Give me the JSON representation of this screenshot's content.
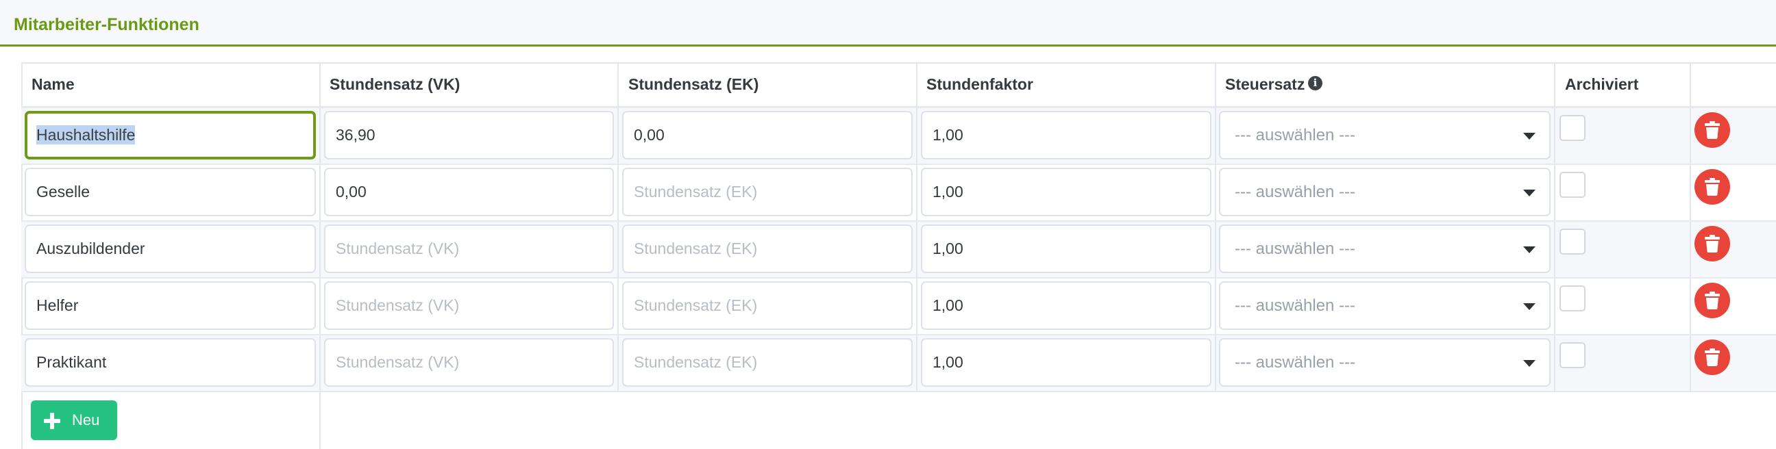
{
  "panel": {
    "title": "Mitarbeiter-Funktionen"
  },
  "table": {
    "headers": {
      "name": "Name",
      "vk": "Stundensatz (VK)",
      "ek": "Stundensatz (EK)",
      "factor": "Stundenfaktor",
      "tax": "Steuersatz",
      "archived": "Archiviert"
    },
    "placeholders": {
      "vk": "Stundensatz (VK)",
      "ek": "Stundensatz (EK)"
    },
    "select_placeholder": "--- auswählen ---",
    "rows": [
      {
        "name": "Haushaltshilfe",
        "vk": "36,90",
        "ek": "0,00",
        "factor": "1,00",
        "tax": "--- auswählen ---",
        "archived": false
      },
      {
        "name": "Geselle",
        "vk": "0,00",
        "ek": "",
        "factor": "1,00",
        "tax": "--- auswählen ---",
        "archived": false
      },
      {
        "name": "Auszubildender",
        "vk": "",
        "ek": "",
        "factor": "1,00",
        "tax": "--- auswählen ---",
        "archived": false
      },
      {
        "name": "Helfer",
        "vk": "",
        "ek": "",
        "factor": "1,00",
        "tax": "--- auswählen ---",
        "archived": false
      },
      {
        "name": "Praktikant",
        "vk": "",
        "ek": "",
        "factor": "1,00",
        "tax": "--- auswählen ---",
        "archived": false
      }
    ]
  },
  "new_button": {
    "label": "Neu"
  },
  "colors": {
    "accent": "#6e9a16",
    "delete": "#e8443a",
    "new": "#26c281"
  },
  "icons": {
    "info": "info-circle-icon",
    "delete": "trash-icon",
    "add": "plus-icon",
    "dropdown": "chevron-down-icon"
  }
}
